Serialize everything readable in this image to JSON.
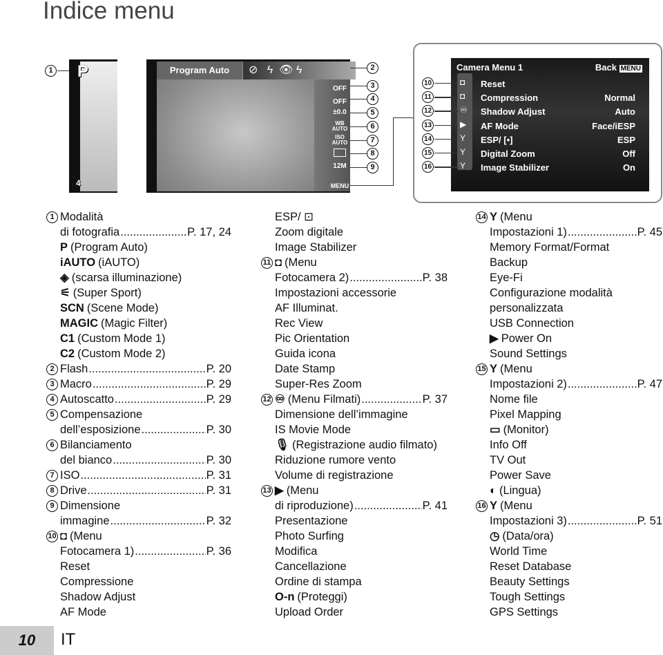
{
  "title": "Indice menu",
  "screen_left": {
    "mode_icon": "P",
    "status": "4"
  },
  "screen_main": {
    "mode_label": "Program Auto",
    "right_icons": [
      "OFF",
      "OFF",
      "±0.0",
      "WB AUTO",
      "ISO AUTO",
      "drive-icon",
      "12M"
    ],
    "menu_label": "MENU"
  },
  "callouts_top": [
    "1",
    "2",
    "3",
    "4",
    "5",
    "6",
    "7",
    "8",
    "9"
  ],
  "menu_panel": {
    "title": "Camera Menu 1",
    "back": "Back",
    "back_key": "MENU",
    "tab_numbers": [
      "10",
      "11",
      "12",
      "13",
      "14",
      "15",
      "16"
    ],
    "rows": [
      {
        "label": "Reset",
        "value": ""
      },
      {
        "label": "Compression",
        "value": "Normal"
      },
      {
        "label": "Shadow Adjust",
        "value": "Auto"
      },
      {
        "label": "AF Mode",
        "value": "Face/iESP"
      },
      {
        "label": "ESP/ [•]",
        "value": "ESP"
      },
      {
        "label": "Digital Zoom",
        "value": "Off"
      },
      {
        "label": "Image Stabilizer",
        "value": "On"
      }
    ]
  },
  "columns": [
    [
      {
        "num": "1",
        "text": "Modalità"
      },
      {
        "text": "di fotografia",
        "page": "P. 17, 24"
      },
      {
        "icon": "P",
        "text": "(Program Auto)"
      },
      {
        "icon": "iAUTO",
        "text": "(iAUTO)"
      },
      {
        "icon": "◈",
        "text": "(scarsa illuminazione)"
      },
      {
        "icon": "⚟",
        "text": "(Super Sport)"
      },
      {
        "icon": "SCN",
        "text": "(Scene Mode)"
      },
      {
        "icon": "MAGIC",
        "text": "(Magic Filter)"
      },
      {
        "icon": "C1",
        "text": "(Custom Mode 1)"
      },
      {
        "icon": "C2",
        "text": "(Custom Mode 2)"
      },
      {
        "num": "2",
        "text": "Flash",
        "page": "P. 20"
      },
      {
        "num": "3",
        "text": "Macro",
        "page": "P. 29"
      },
      {
        "num": "4",
        "text": "Autoscatto",
        "page": "P. 29"
      },
      {
        "num": "5",
        "text": "Compensazione"
      },
      {
        "text": "dell’esposizione",
        "page": "P. 30"
      },
      {
        "num": "6",
        "text": "Bilanciamento"
      },
      {
        "text": "del bianco",
        "page": "P. 30"
      },
      {
        "num": "7",
        "text": "ISO",
        "page": "P. 31"
      },
      {
        "num": "8",
        "text": "Drive",
        "page": "P. 31"
      },
      {
        "num": "9",
        "text": "Dimensione"
      },
      {
        "text": "immagine",
        "page": "P. 32"
      },
      {
        "num": "10",
        "icon": "◘",
        "text": "(Menu"
      },
      {
        "text": "Fotocamera 1)",
        "page": "P. 36"
      },
      {
        "text": "Reset"
      },
      {
        "text": "Compressione"
      },
      {
        "text": "Shadow Adjust"
      },
      {
        "text": "AF Mode"
      }
    ],
    [
      {
        "text": "ESP/ ⊡"
      },
      {
        "text": "Zoom digitale"
      },
      {
        "text": "Image Stabilizer"
      },
      {
        "num": "11",
        "icon": "◘",
        "text": "(Menu"
      },
      {
        "text": "Fotocamera 2)",
        "page": "P. 38"
      },
      {
        "text": "Impostazioni accessorie"
      },
      {
        "text": "AF Illuminat."
      },
      {
        "text": "Rec View"
      },
      {
        "text": "Pic Orientation"
      },
      {
        "text": "Guida icona"
      },
      {
        "text": "Date Stamp"
      },
      {
        "text": "Super-Res Zoom"
      },
      {
        "num": "12",
        "icon": "♾",
        "text": "(Menu Filmati)",
        "page": "P. 37"
      },
      {
        "text": "Dimensione dell’immagine"
      },
      {
        "text": "IS Movie Mode"
      },
      {
        "icon": "🎙",
        "text": "(Registrazione audio filmato)"
      },
      {
        "text": "Riduzione rumore vento"
      },
      {
        "text": "Volume di registrazione"
      },
      {
        "num": "13",
        "icon": "▶",
        "text": "(Menu"
      },
      {
        "text": "di riproduzione)",
        "page": "P. 41"
      },
      {
        "text": "Presentazione"
      },
      {
        "text": "Photo Surfing"
      },
      {
        "text": "Modifica"
      },
      {
        "text": "Cancellazione"
      },
      {
        "text": "Ordine di stampa"
      },
      {
        "icon": "O-n",
        "text": "(Proteggi)"
      },
      {
        "text": "Upload Order"
      }
    ],
    [
      {
        "num": "14",
        "icon": "Y",
        "text": "(Menu"
      },
      {
        "text": "Impostazioni 1)",
        "page": "P. 45"
      },
      {
        "text": "Memory Format/Format"
      },
      {
        "text": "Backup"
      },
      {
        "text": "Eye-Fi"
      },
      {
        "text": "Configurazione modalità"
      },
      {
        "text": " personalizzata"
      },
      {
        "text": "USB Connection"
      },
      {
        "icon": "▶",
        "text": "Power On"
      },
      {
        "text": "Sound Settings"
      },
      {
        "num": "15",
        "icon": "Y",
        "text": "(Menu"
      },
      {
        "text": "Impostazioni 2)",
        "page": "P. 47"
      },
      {
        "text": "Nome file"
      },
      {
        "text": "Pixel Mapping"
      },
      {
        "icon": "▭",
        "text": "(Monitor)"
      },
      {
        "text": "Info Off"
      },
      {
        "text": "TV Out"
      },
      {
        "text": "Power Save"
      },
      {
        "icon": "◐",
        "text": "(Lingua)"
      },
      {
        "num": "16",
        "icon": "Y",
        "text": "(Menu"
      },
      {
        "text": "Impostazioni 3)",
        "page": "P. 51"
      },
      {
        "icon": "◷",
        "text": "(Data/ora)"
      },
      {
        "text": "World Time"
      },
      {
        "text": "Reset Database"
      },
      {
        "text": "Beauty Settings"
      },
      {
        "text": "Tough Settings"
      },
      {
        "text": "GPS Settings"
      }
    ]
  ],
  "footer": {
    "page_number": "10",
    "language": "IT"
  }
}
